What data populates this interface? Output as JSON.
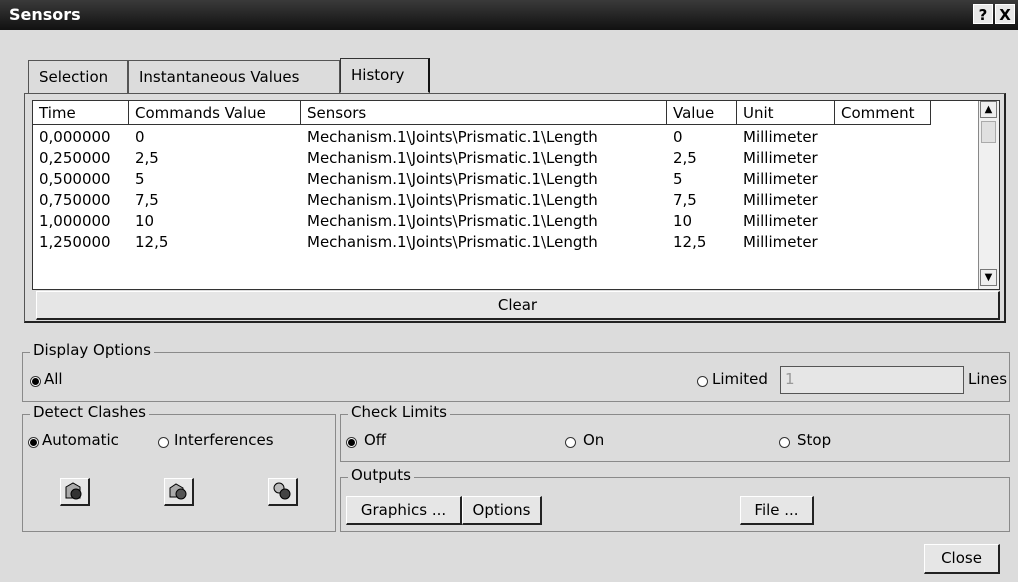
{
  "window": {
    "title": "Sensors",
    "help_btn": "?",
    "close_btn": "X"
  },
  "tabs": [
    {
      "label": "Selection"
    },
    {
      "label": "Instantaneous Values"
    },
    {
      "label": "History"
    }
  ],
  "table": {
    "columns": [
      "Time",
      "Commands Value",
      "Sensors",
      "Value",
      "Unit",
      "Comment"
    ],
    "rows": [
      [
        "0,000000",
        "0",
        "Mechanism.1\\Joints\\Prismatic.1\\Length",
        "0",
        "Millimeter",
        ""
      ],
      [
        "0,250000",
        "2,5",
        "Mechanism.1\\Joints\\Prismatic.1\\Length",
        "2,5",
        "Millimeter",
        ""
      ],
      [
        "0,500000",
        "5",
        "Mechanism.1\\Joints\\Prismatic.1\\Length",
        "5",
        "Millimeter",
        ""
      ],
      [
        "0,750000",
        "7,5",
        "Mechanism.1\\Joints\\Prismatic.1\\Length",
        "7,5",
        "Millimeter",
        ""
      ],
      [
        "1,000000",
        "10",
        "Mechanism.1\\Joints\\Prismatic.1\\Length",
        "10",
        "Millimeter",
        ""
      ],
      [
        "1,250000",
        "12,5",
        "Mechanism.1\\Joints\\Prismatic.1\\Length",
        "12,5",
        "Millimeter",
        ""
      ]
    ]
  },
  "clear_btn": "Clear",
  "display_options": {
    "title": "Display Options",
    "all": "All",
    "limited": "Limited",
    "limited_value": "1",
    "lines": "Lines"
  },
  "detect_clashes": {
    "title": "Detect Clashes",
    "automatic": "Automatic",
    "interferences": "Interferences"
  },
  "check_limits": {
    "title": "Check Limits",
    "off": "Off",
    "on": "On",
    "stop": "Stop"
  },
  "outputs": {
    "title": "Outputs",
    "graphics": "Graphics ...",
    "options": "Options",
    "file": "File ..."
  },
  "close_label": "Close"
}
